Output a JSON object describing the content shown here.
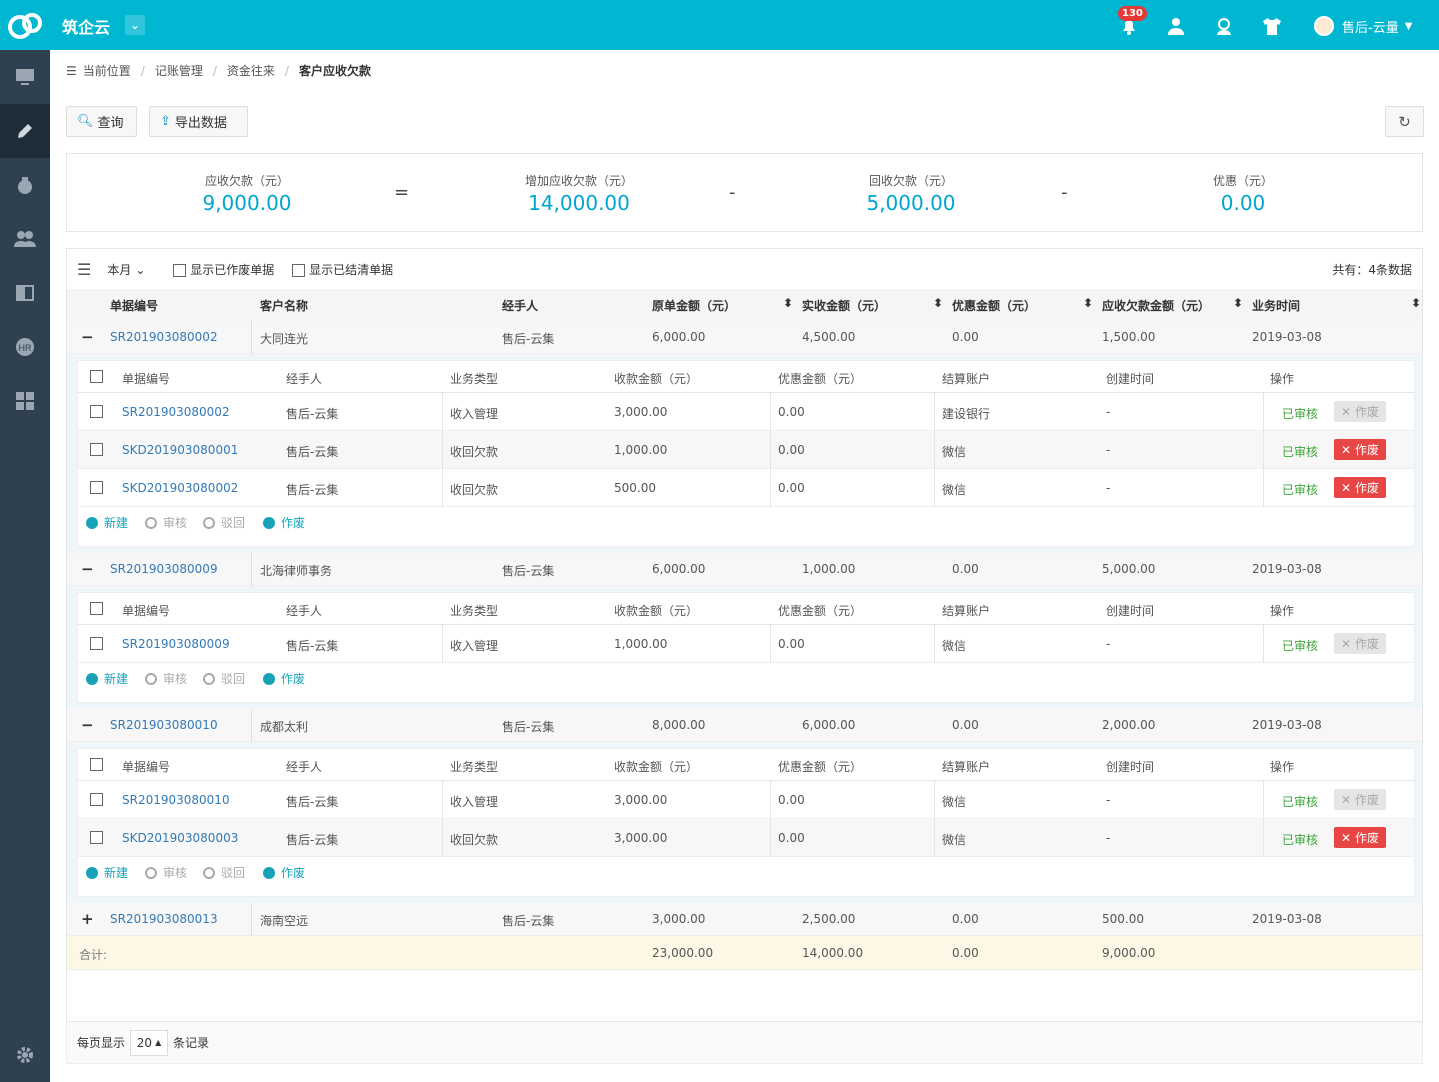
{
  "app": {
    "brand": "筑企云",
    "notif_count": "130",
    "user": "售后-云量"
  },
  "breadcrumb": {
    "prefix": "当前位置",
    "l1": "记账管理",
    "l2": "资金往来",
    "current": "客户应收欠款"
  },
  "actions": {
    "query": "查询",
    "export": "导出数据"
  },
  "summary": {
    "receivable_label": "应收欠款（元）",
    "receivable": "9,000.00",
    "eq": "=",
    "add_label": "增加应收欠款（元）",
    "add": "14,000.00",
    "minus1": "-",
    "collect_label": "回收欠款（元）",
    "collect": "5,000.00",
    "minus2": "-",
    "discount_label": "优惠（元）",
    "discount": "0.00"
  },
  "toolbar": {
    "period": "本月",
    "show_void": "显示已作废单据",
    "show_closed": "显示已结清单据",
    "total": "共有：4条数据"
  },
  "cols": {
    "no": "单据编号",
    "customer": "客户名称",
    "handler": "经手人",
    "orig": "原单金额（元）",
    "received": "实收金额（元）",
    "disc": "优惠金额（元）",
    "owed": "应收欠款金额（元）",
    "date": "业务时间"
  },
  "subcols": {
    "no": "单据编号",
    "handler": "经手人",
    "type": "业务类型",
    "amount": "收款金额（元）",
    "disc": "优惠金额（元）",
    "account": "结算账户",
    "created": "创建时间",
    "op": "操作"
  },
  "rows": [
    {
      "toggle": "−",
      "no": "SR201903080002",
      "customer": "大同连光",
      "handler": "售后-云集",
      "orig": "6,000.00",
      "received": "4,500.00",
      "disc": "0.00",
      "owed": "1,500.00",
      "date": "2019-03-08"
    },
    {
      "toggle": "−",
      "no": "SR201903080009",
      "customer": "北海律师事务",
      "handler": "售后-云集",
      "orig": "6,000.00",
      "received": "1,000.00",
      "disc": "0.00",
      "owed": "5,000.00",
      "date": "2019-03-08"
    },
    {
      "toggle": "−",
      "no": "SR201903080010",
      "customer": "成都太利",
      "handler": "售后-云集",
      "orig": "8,000.00",
      "received": "6,000.00",
      "disc": "0.00",
      "owed": "2,000.00",
      "date": "2019-03-08"
    },
    {
      "toggle": "+",
      "no": "SR201903080013",
      "customer": "海南空远",
      "handler": "售后-云集",
      "orig": "3,000.00",
      "received": "2,500.00",
      "disc": "0.00",
      "owed": "500.00",
      "date": "2019-03-08"
    }
  ],
  "sub1": [
    {
      "no": "SR201903080002",
      "handler": "售后-云集",
      "type": "收入管理",
      "amount": "3,000.00",
      "disc": "0.00",
      "account": "建设银行",
      "created": "-",
      "status": "已审核",
      "void": "作废",
      "void_enabled": false
    },
    {
      "no": "SKD201903080001",
      "handler": "售后-云集",
      "type": "收回欠款",
      "amount": "1,000.00",
      "disc": "0.00",
      "account": "微信",
      "created": "-",
      "status": "已审核",
      "void": "作废",
      "void_enabled": true
    },
    {
      "no": "SKD201903080002",
      "handler": "售后-云集",
      "type": "收回欠款",
      "amount": "500.00",
      "disc": "0.00",
      "account": "微信",
      "created": "-",
      "status": "已审核",
      "void": "作废",
      "void_enabled": true
    }
  ],
  "sub2": [
    {
      "no": "SR201903080009",
      "handler": "售后-云集",
      "type": "收入管理",
      "amount": "1,000.00",
      "disc": "0.00",
      "account": "微信",
      "created": "-",
      "status": "已审核",
      "void": "作废",
      "void_enabled": false
    }
  ],
  "sub3": [
    {
      "no": "SR201903080010",
      "handler": "售后-云集",
      "type": "收入管理",
      "amount": "3,000.00",
      "disc": "0.00",
      "account": "微信",
      "created": "-",
      "status": "已审核",
      "void": "作废",
      "void_enabled": false
    },
    {
      "no": "SKD201903080003",
      "handler": "售后-云集",
      "type": "收回欠款",
      "amount": "3,000.00",
      "disc": "0.00",
      "account": "微信",
      "created": "-",
      "status": "已审核",
      "void": "作废",
      "void_enabled": true
    }
  ],
  "subactions": {
    "new": "新建",
    "audit": "审核",
    "reject": "驳回",
    "void": "作废"
  },
  "totals": {
    "label": "合计:",
    "orig": "23,000.00",
    "received": "14,000.00",
    "disc": "0.00",
    "owed": "9,000.00"
  },
  "pager": {
    "prefix": "每页显示",
    "size": "20",
    "suffix": "条记录"
  }
}
